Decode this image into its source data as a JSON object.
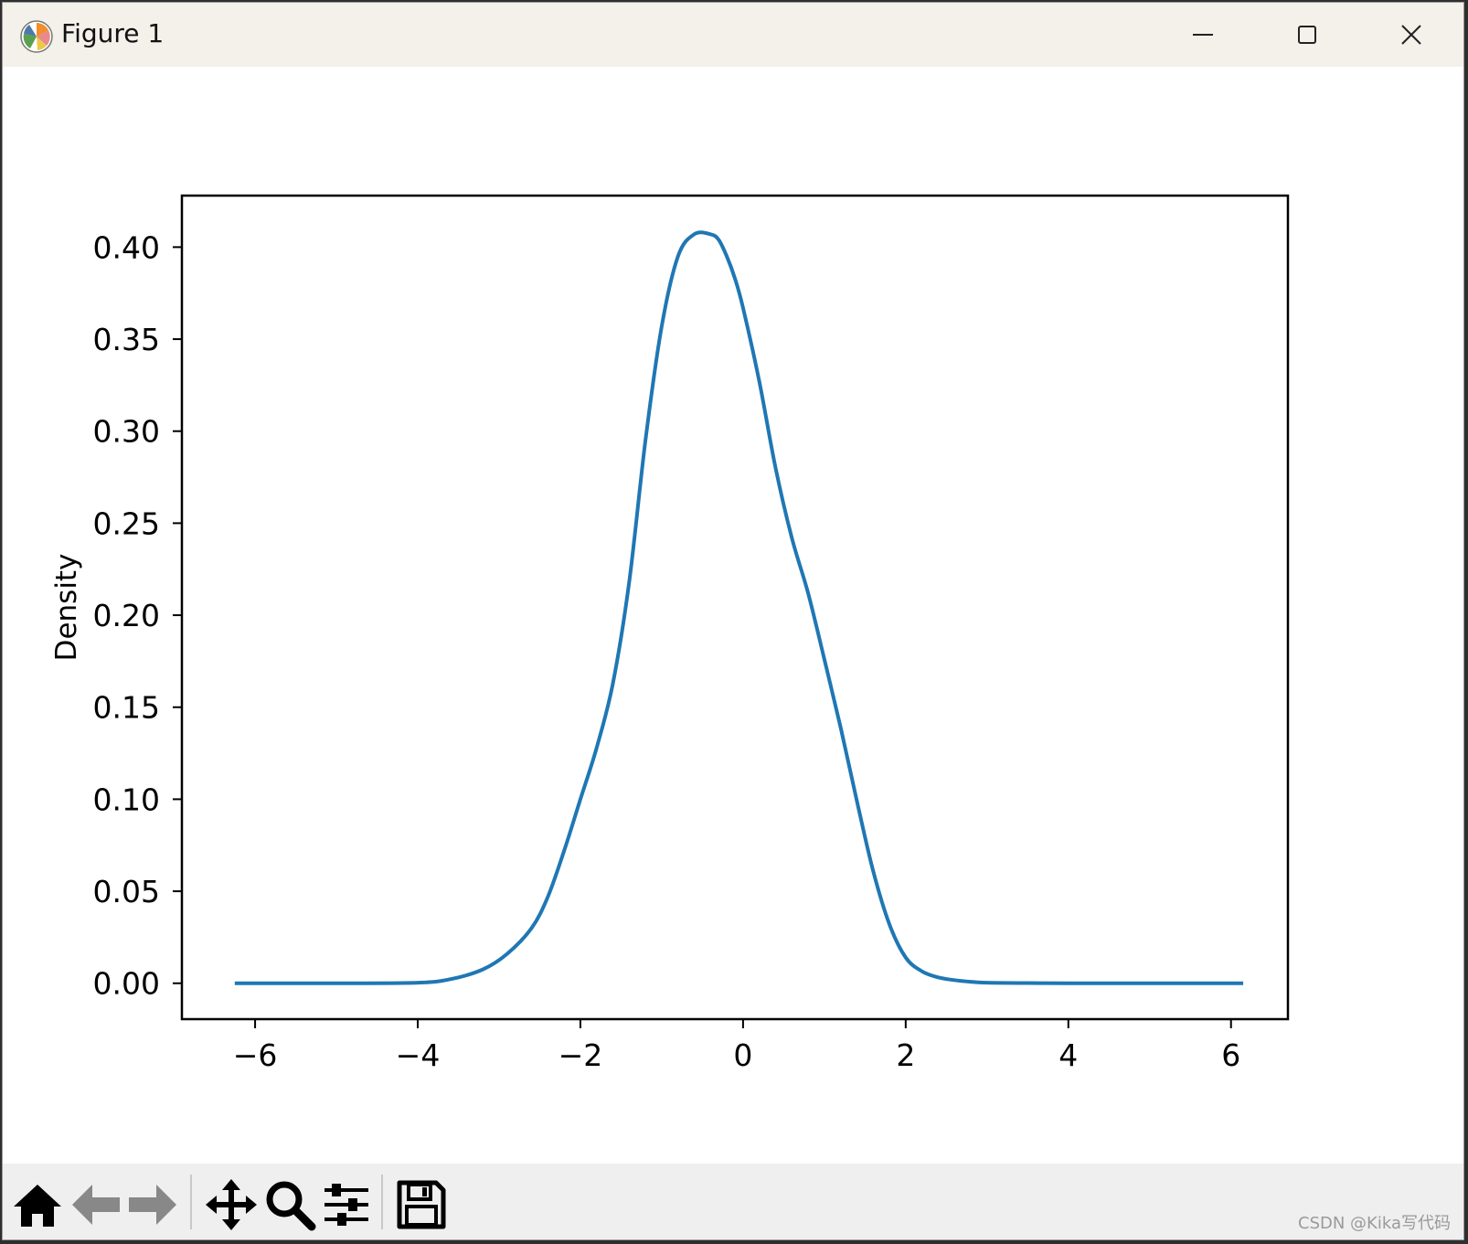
{
  "window": {
    "title": "Figure 1"
  },
  "toolbar": {
    "items": [
      "home-icon",
      "back-icon",
      "forward-icon",
      "pan-icon",
      "zoom-icon",
      "configure-subplots-icon",
      "save-icon"
    ]
  },
  "watermark": "CSDN @Kika写代码",
  "chart_data": {
    "type": "line",
    "title": "",
    "xlabel": "",
    "ylabel": "Density",
    "xlim": [
      -6.9,
      6.7
    ],
    "ylim": [
      -0.0195,
      0.428
    ],
    "xticks": [
      -6,
      -4,
      -2,
      0,
      2,
      4,
      6
    ],
    "xtick_labels": [
      "−6",
      "−4",
      "−2",
      "0",
      "2",
      "4",
      "6"
    ],
    "yticks": [
      0.0,
      0.05,
      0.1,
      0.15,
      0.2,
      0.25,
      0.3,
      0.35,
      0.4
    ],
    "ytick_labels": [
      "0.00",
      "0.05",
      "0.10",
      "0.15",
      "0.20",
      "0.25",
      "0.30",
      "0.35",
      "0.40"
    ],
    "grid": false,
    "line_color": "#1f77b4",
    "series": [
      {
        "x": [
          -6.25,
          -5.0,
          -4.0,
          -3.6,
          -3.2,
          -2.9,
          -2.6,
          -2.4,
          -2.2,
          -2.0,
          -1.8,
          -1.6,
          -1.4,
          -1.2,
          -1.0,
          -0.8,
          -0.6,
          -0.4,
          -0.3,
          -0.2,
          -0.1,
          0.0,
          0.2,
          0.4,
          0.6,
          0.8,
          1.0,
          1.2,
          1.4,
          1.6,
          1.8,
          2.0,
          2.2,
          2.4,
          2.6,
          2.8,
          3.0,
          3.5,
          4.0,
          5.0,
          6.15
        ],
        "y": [
          0.0,
          0.0,
          0.0003,
          0.0022,
          0.0075,
          0.016,
          0.03,
          0.047,
          0.072,
          0.1,
          0.128,
          0.163,
          0.218,
          0.295,
          0.357,
          0.395,
          0.407,
          0.407,
          0.404,
          0.395,
          0.383,
          0.367,
          0.327,
          0.28,
          0.242,
          0.212,
          0.176,
          0.139,
          0.099,
          0.061,
          0.032,
          0.014,
          0.0065,
          0.0032,
          0.0017,
          0.0008,
          0.0003,
          0.0001,
          0.0,
          0.0,
          0.0
        ]
      }
    ]
  }
}
